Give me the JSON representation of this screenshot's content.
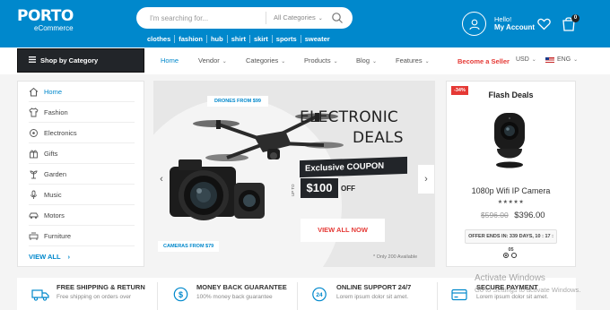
{
  "header": {
    "logo": "PORTO",
    "logo_sub": "eCommerce",
    "search_placeholder": "I'm searching for...",
    "search_category": "All Categories",
    "tags": [
      "clothes",
      "fashion",
      "hub",
      "shirt",
      "skirt",
      "sports",
      "sweater"
    ],
    "hello": "Hello!",
    "my_account": "My Account",
    "cart_count": "0"
  },
  "nav": {
    "shop_by_category": "Shop by Category",
    "items": [
      "Home",
      "Vendor",
      "Categories",
      "Products",
      "Blog",
      "Features"
    ],
    "become_seller": "Become a Seller",
    "currency": "USD",
    "language": "ENG"
  },
  "sidebar": {
    "categories": [
      "Home",
      "Fashion",
      "Electronics",
      "Gifts",
      "Garden",
      "Music",
      "Motors",
      "Furniture"
    ],
    "view_all": "VIEW ALL"
  },
  "banner": {
    "drone_tag": "DRONES FROM $99",
    "camera_tag": "CAMERAS FROM $79",
    "title_line1": "ELECTRONIC",
    "title_line2": "DEALS",
    "coupon": "Exclusive COUPON",
    "up_to": "UP TO",
    "amount": "$100",
    "off": "OFF",
    "button": "VIEW ALL NOW",
    "note": "* Only 200 Available"
  },
  "flash": {
    "badge": "-34%",
    "title": "Flash Deals",
    "product": "1080p Wifi IP Camera",
    "rating_stars": "★★★★★",
    "old_price": "$596.00",
    "new_price": "$396.00",
    "timer": "OFFER ENDS IN: 339 DAYS, 10 : 17 : 05"
  },
  "features": [
    {
      "title": "FREE SHIPPING & RETURN",
      "sub": "Free shipping on orders over"
    },
    {
      "title": "MONEY BACK GUARANTEE",
      "sub": "100% money back guarantee"
    },
    {
      "title": "ONLINE SUPPORT 24/7",
      "sub": "Lorem ipsum dolor sit amet."
    },
    {
      "title": "SECURE PAYMENT",
      "sub": "Lorem ipsum dolor sit amet."
    }
  ],
  "watermark": {
    "line1": "Activate Windows",
    "line2": "Go to Settings to activate Windows."
  },
  "colors": {
    "brand_blue": "#0088cc",
    "dark": "#222529",
    "accent_red": "#e53935"
  }
}
